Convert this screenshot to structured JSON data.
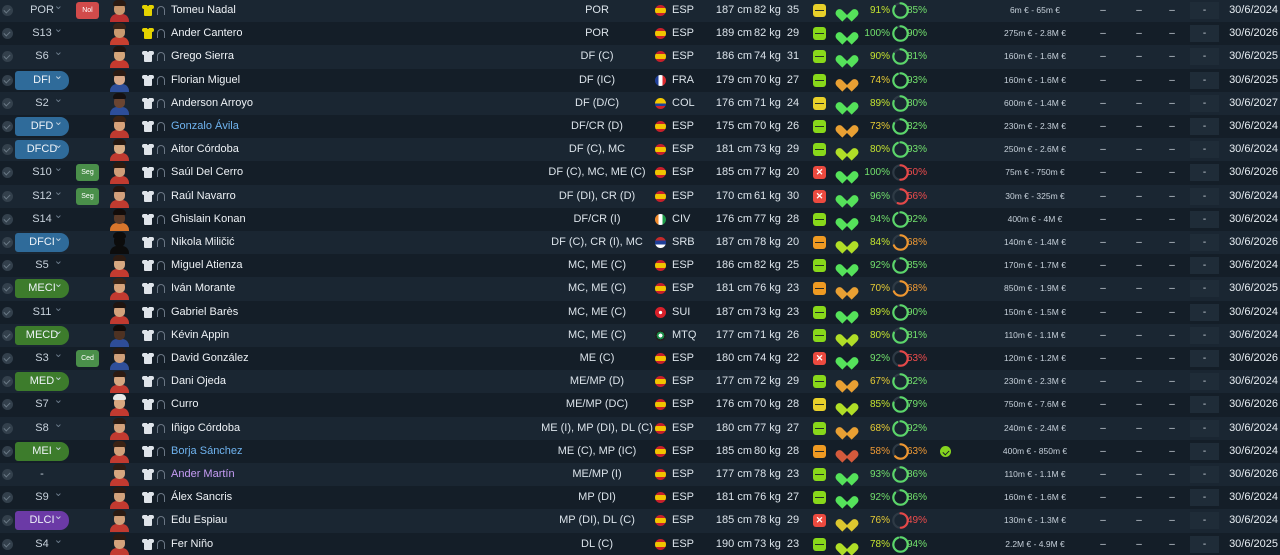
{
  "app": {
    "view": "squad-list",
    "colors": {
      "background": "#16212b",
      "row_even": "#1a2632",
      "row_odd": "#141e28",
      "chip_blue": "#2f6b9a",
      "chip_green": "#3d7c2c",
      "chip_purple": "#6b3aa6",
      "loan_name": "#6fb3ef",
      "purple_name": "#c69cf5",
      "role_red": "#d24b4b",
      "role_green": "#4a8f4a"
    }
  },
  "players": [
    {
      "pos": "POR",
      "pos_style": "plain",
      "role": "Nol",
      "role_style": "red",
      "face": [
        "#2a1a12",
        "#c9986e",
        "#bb3030"
      ],
      "shirt": "gk",
      "tag": true,
      "name": "Tomeu Nadal",
      "name_style": "normal",
      "positions": "POR",
      "flag": "esp",
      "nat": "ESP",
      "height": "187 cm",
      "weight": "82 kg",
      "age": "35",
      "morale": "mid",
      "heart": "green",
      "cond": "91%",
      "cond_color": "lime",
      "cond_level": 0.91,
      "sharp": "85%",
      "sharp_color": "green",
      "sharp_level": 0.85,
      "extra": false,
      "value": "6m € - 65m €",
      "d1": "–",
      "d2": "–",
      "d3": "–",
      "d4": "-",
      "contract": "30/6/2024"
    },
    {
      "pos": "S13",
      "pos_style": "plain",
      "role": "",
      "role_style": "",
      "face": [
        "#3a2418",
        "#c99a70",
        "#c84030"
      ],
      "shirt": "gk",
      "tag": true,
      "name": "Ander Cantero",
      "name_style": "normal",
      "positions": "POR",
      "flag": "esp",
      "nat": "ESP",
      "height": "189 cm",
      "weight": "82 kg",
      "age": "29",
      "morale": "pos",
      "heart": "green",
      "cond": "100%",
      "cond_color": "green",
      "cond_level": 1.0,
      "sharp": "90%",
      "sharp_color": "green",
      "sharp_level": 0.9,
      "extra": false,
      "value": "275m € - 2.8M €",
      "d1": "–",
      "d2": "–",
      "d3": "–",
      "d4": "-",
      "contract": "30/6/2026"
    },
    {
      "pos": "S6",
      "pos_style": "plain",
      "role": "",
      "role_style": "",
      "face": [
        "#1d1410",
        "#d4a57a",
        "#c73a2f"
      ],
      "shirt": "fd",
      "tag": true,
      "name": "Grego Sierra",
      "name_style": "normal",
      "positions": "DF (C)",
      "flag": "esp",
      "nat": "ESP",
      "height": "186 cm",
      "weight": "74 kg",
      "age": "31",
      "morale": "pos",
      "heart": "green",
      "cond": "90%",
      "cond_color": "lime",
      "cond_level": 0.9,
      "sharp": "81%",
      "sharp_color": "green",
      "sharp_level": 0.81,
      "extra": false,
      "value": "160m € - 1.6M €",
      "d1": "–",
      "d2": "–",
      "d3": "–",
      "d4": "-",
      "contract": "30/6/2025"
    },
    {
      "pos": "DFI",
      "pos_style": "blue",
      "role": "",
      "role_style": "",
      "face": [
        "#2b1a12",
        "#d8a98a",
        "#2f4f9a"
      ],
      "shirt": "fd",
      "tag": true,
      "name": "Florian Miguel",
      "name_style": "normal",
      "positions": "DF (IC)",
      "flag": "fra",
      "nat": "FRA",
      "height": "179 cm",
      "weight": "70 kg",
      "age": "27",
      "morale": "pos",
      "heart": "amber",
      "cond": "74%",
      "cond_color": "yellow",
      "cond_level": 0.74,
      "sharp": "93%",
      "sharp_color": "green",
      "sharp_level": 0.93,
      "extra": false,
      "value": "160m € - 1.6M €",
      "d1": "–",
      "d2": "–",
      "d3": "–",
      "d4": "-",
      "contract": "30/6/2025"
    },
    {
      "pos": "S2",
      "pos_style": "plain",
      "role": "",
      "role_style": "",
      "face": [
        "#151010",
        "#6b4532",
        "#2d4e9a"
      ],
      "shirt": "fd",
      "tag": true,
      "name": "Anderson Arroyo",
      "name_style": "normal",
      "positions": "DF (D/C)",
      "flag": "col",
      "nat": "COL",
      "height": "176 cm",
      "weight": "71 kg",
      "age": "24",
      "morale": "mid",
      "heart": "green",
      "cond": "89%",
      "cond_color": "lime",
      "cond_level": 0.89,
      "sharp": "80%",
      "sharp_color": "green",
      "sharp_level": 0.8,
      "extra": false,
      "value": "600m € - 1.4M €",
      "d1": "–",
      "d2": "–",
      "d3": "–",
      "d4": "-",
      "contract": "30/6/2027"
    },
    {
      "pos": "DFD",
      "pos_style": "blue",
      "role": "",
      "role_style": "",
      "face": [
        "#3c2314",
        "#d7a27a",
        "#bf3a30"
      ],
      "shirt": "fd",
      "tag": true,
      "name": "Gonzalo Ávila",
      "name_style": "loan",
      "positions": "DF/CR (D)",
      "flag": "esp",
      "nat": "ESP",
      "height": "175 cm",
      "weight": "70 kg",
      "age": "26",
      "morale": "pos",
      "heart": "amber",
      "cond": "73%",
      "cond_color": "yellow",
      "cond_level": 0.73,
      "sharp": "82%",
      "sharp_color": "green",
      "sharp_level": 0.82,
      "extra": false,
      "value": "230m € - 2.3M €",
      "d1": "–",
      "d2": "–",
      "d3": "–",
      "d4": "-",
      "contract": "30/6/2024"
    },
    {
      "pos": "DFCD",
      "pos_style": "blue",
      "role": "",
      "role_style": "",
      "face": [
        "#241710",
        "#d9ae86",
        "#c03a30"
      ],
      "shirt": "fd",
      "tag": true,
      "name": "Aitor Córdoba",
      "name_style": "normal",
      "positions": "DF (C), MC",
      "flag": "esp",
      "nat": "ESP",
      "height": "181 cm",
      "weight": "73 kg",
      "age": "29",
      "morale": "pos",
      "heart": "lime",
      "cond": "80%",
      "cond_color": "lime",
      "cond_level": 0.8,
      "sharp": "93%",
      "sharp_color": "green",
      "sharp_level": 0.93,
      "extra": false,
      "value": "250m € - 2.6M €",
      "d1": "–",
      "d2": "–",
      "d3": "–",
      "d4": "-",
      "contract": "30/6/2024"
    },
    {
      "pos": "S10",
      "pos_style": "plain",
      "role": "Seg",
      "role_style": "green",
      "face": [
        "#2a1a10",
        "#cf9d78",
        "#c13b30"
      ],
      "shirt": "fd",
      "tag": true,
      "name": "Saúl Del Cerro",
      "name_style": "normal",
      "positions": "DF (C), MC, ME (C)",
      "flag": "esp",
      "nat": "ESP",
      "height": "185 cm",
      "weight": "77 kg",
      "age": "20",
      "morale": "neg",
      "heart": "green",
      "cond": "100%",
      "cond_color": "green",
      "cond_level": 1.0,
      "sharp": "50%",
      "sharp_color": "red",
      "sharp_level": 0.5,
      "extra": false,
      "value": "75m € - 750m €",
      "d1": "–",
      "d2": "–",
      "d3": "–",
      "d4": "-",
      "contract": "30/6/2026"
    },
    {
      "pos": "S12",
      "pos_style": "plain",
      "role": "Seg",
      "role_style": "green",
      "face": [
        "#221510",
        "#d2a07c",
        "#c13b30"
      ],
      "shirt": "fd",
      "tag": true,
      "name": "Raúl Navarro",
      "name_style": "normal",
      "positions": "DF (DI), CR (D)",
      "flag": "esp",
      "nat": "ESP",
      "height": "170 cm",
      "weight": "61 kg",
      "age": "30",
      "morale": "neg",
      "heart": "green",
      "cond": "96%",
      "cond_color": "green",
      "cond_level": 0.96,
      "sharp": "56%",
      "sharp_color": "red",
      "sharp_level": 0.56,
      "extra": false,
      "value": "30m € - 325m €",
      "d1": "–",
      "d2": "–",
      "d3": "–",
      "d4": "-",
      "contract": "30/6/2024"
    },
    {
      "pos": "S14",
      "pos_style": "plain",
      "role": "",
      "role_style": "",
      "face": [
        "#120c0a",
        "#5a3a28",
        "#d8762c"
      ],
      "shirt": "fd",
      "tag": true,
      "name": "Ghislain Konan",
      "name_style": "normal",
      "positions": "DF/CR (I)",
      "flag": "civ",
      "nat": "CIV",
      "height": "176 cm",
      "weight": "77 kg",
      "age": "28",
      "morale": "pos",
      "heart": "green",
      "cond": "94%",
      "cond_color": "green",
      "cond_level": 0.94,
      "sharp": "92%",
      "sharp_color": "green",
      "sharp_level": 0.92,
      "extra": false,
      "value": "400m € - 4M €",
      "d1": "–",
      "d2": "–",
      "d3": "–",
      "d4": "-",
      "contract": "30/6/2024"
    },
    {
      "pos": "DFCI",
      "pos_style": "blue",
      "role": "",
      "role_style": "",
      "face": [
        "#0c0c0c",
        "#0c0c0c",
        "#0c0c0c"
      ],
      "shirt": "fd",
      "tag": true,
      "name": "Nikola Miličić",
      "name_style": "normal",
      "positions": "DF (C), CR (I), MC",
      "flag": "srb",
      "nat": "SRB",
      "height": "187 cm",
      "weight": "78 kg",
      "age": "20",
      "morale": "low",
      "heart": "lime",
      "cond": "84%",
      "cond_color": "lime",
      "cond_level": 0.84,
      "sharp": "68%",
      "sharp_color": "amber",
      "sharp_level": 0.68,
      "extra": false,
      "value": "140m € - 1.4M €",
      "d1": "–",
      "d2": "–",
      "d3": "–",
      "d4": "-",
      "contract": "30/6/2026"
    },
    {
      "pos": "S5",
      "pos_style": "plain",
      "role": "",
      "role_style": "",
      "face": [
        "#2c1b12",
        "#d6a882",
        "#c33b30"
      ],
      "shirt": "fd",
      "tag": true,
      "name": "Miguel Atienza",
      "name_style": "normal",
      "positions": "MC, ME (C)",
      "flag": "esp",
      "nat": "ESP",
      "height": "186 cm",
      "weight": "82 kg",
      "age": "25",
      "morale": "pos",
      "heart": "green",
      "cond": "92%",
      "cond_color": "green",
      "cond_level": 0.92,
      "sharp": "85%",
      "sharp_color": "green",
      "sharp_level": 0.85,
      "extra": false,
      "value": "170m € - 1.7M €",
      "d1": "–",
      "d2": "–",
      "d3": "–",
      "d4": "-",
      "contract": "30/6/2024"
    },
    {
      "pos": "MECI",
      "pos_style": "green",
      "role": "",
      "role_style": "",
      "face": [
        "#3a2416",
        "#d7a47c",
        "#c23a30"
      ],
      "shirt": "fd",
      "tag": true,
      "name": "Iván Morante",
      "name_style": "normal",
      "positions": "MC, ME (C)",
      "flag": "esp",
      "nat": "ESP",
      "height": "181 cm",
      "weight": "76 kg",
      "age": "23",
      "morale": "low",
      "heart": "amber",
      "cond": "70%",
      "cond_color": "yellow",
      "cond_level": 0.7,
      "sharp": "68%",
      "sharp_color": "amber",
      "sharp_level": 0.68,
      "extra": false,
      "value": "850m € - 1.9M €",
      "d1": "–",
      "d2": "–",
      "d3": "–",
      "d4": "-",
      "contract": "30/6/2025"
    },
    {
      "pos": "S11",
      "pos_style": "plain",
      "role": "",
      "role_style": "",
      "face": [
        "#1f1410",
        "#d3a27c",
        "#c13a30"
      ],
      "shirt": "fd",
      "tag": true,
      "name": "Gabriel Barès",
      "name_style": "normal",
      "positions": "MC, ME (C)",
      "flag": "sui",
      "nat": "SUI",
      "height": "187 cm",
      "weight": "73 kg",
      "age": "23",
      "morale": "pos",
      "heart": "green",
      "cond": "89%",
      "cond_color": "lime",
      "cond_level": 0.89,
      "sharp": "90%",
      "sharp_color": "green",
      "sharp_level": 0.9,
      "extra": false,
      "value": "150m € - 1.5M €",
      "d1": "–",
      "d2": "–",
      "d3": "–",
      "d4": "-",
      "contract": "30/6/2024"
    },
    {
      "pos": "MECD",
      "pos_style": "green",
      "role": "",
      "role_style": "",
      "face": [
        "#120c0a",
        "#4e3222",
        "#2e4d98"
      ],
      "shirt": "fd",
      "tag": true,
      "name": "Kévin Appin",
      "name_style": "normal",
      "positions": "MC, ME (C)",
      "flag": "mtq",
      "nat": "MTQ",
      "height": "177 cm",
      "weight": "71 kg",
      "age": "26",
      "morale": "pos",
      "heart": "lime",
      "cond": "80%",
      "cond_color": "lime",
      "cond_level": 0.8,
      "sharp": "81%",
      "sharp_color": "green",
      "sharp_level": 0.81,
      "extra": false,
      "value": "110m € - 1.1M €",
      "d1": "–",
      "d2": "–",
      "d3": "–",
      "d4": "-",
      "contract": "30/6/2024"
    },
    {
      "pos": "S3",
      "pos_style": "plain",
      "role": "Ced",
      "role_style": "green",
      "face": [
        "#2a1a12",
        "#d0a07a",
        "#2f4f9a"
      ],
      "shirt": "fd",
      "tag": true,
      "name": "David González",
      "name_style": "normal",
      "positions": "ME (C)",
      "flag": "esp",
      "nat": "ESP",
      "height": "180 cm",
      "weight": "74 kg",
      "age": "22",
      "morale": "neg",
      "heart": "green",
      "cond": "92%",
      "cond_color": "green",
      "cond_level": 0.92,
      "sharp": "53%",
      "sharp_color": "red",
      "sharp_level": 0.53,
      "extra": false,
      "value": "120m € - 1.2M €",
      "d1": "–",
      "d2": "–",
      "d3": "–",
      "d4": "-",
      "contract": "30/6/2026"
    },
    {
      "pos": "MED",
      "pos_style": "green",
      "role": "",
      "role_style": "",
      "face": [
        "#2b1a12",
        "#d6a680",
        "#c23a30"
      ],
      "shirt": "fd",
      "tag": true,
      "name": "Dani Ojeda",
      "name_style": "normal",
      "positions": "ME/MP (D)",
      "flag": "esp",
      "nat": "ESP",
      "height": "177 cm",
      "weight": "72 kg",
      "age": "29",
      "morale": "pos",
      "heart": "amber",
      "cond": "67%",
      "cond_color": "yellow",
      "cond_level": 0.67,
      "sharp": "82%",
      "sharp_color": "green",
      "sharp_level": 0.82,
      "extra": false,
      "value": "230m € - 2.3M €",
      "d1": "–",
      "d2": "–",
      "d3": "–",
      "d4": "-",
      "contract": "30/6/2024"
    },
    {
      "pos": "S7",
      "pos_style": "plain",
      "role": "",
      "role_style": "",
      "face": [
        "#e8e8e8",
        "#d8a880",
        "#c23a30"
      ],
      "shirt": "fd",
      "tag": true,
      "name": "Curro",
      "name_style": "normal",
      "positions": "ME/MP (DC)",
      "flag": "esp",
      "nat": "ESP",
      "height": "176 cm",
      "weight": "70 kg",
      "age": "28",
      "morale": "mid",
      "heart": "lime",
      "cond": "85%",
      "cond_color": "lime",
      "cond_level": 0.85,
      "sharp": "79%",
      "sharp_color": "green",
      "sharp_level": 0.79,
      "extra": false,
      "value": "750m € - 7.6M €",
      "d1": "–",
      "d2": "–",
      "d3": "–",
      "d4": "-",
      "contract": "30/6/2026"
    },
    {
      "pos": "S8",
      "pos_style": "plain",
      "role": "",
      "role_style": "",
      "face": [
        "#2a1a12",
        "#d4a27c",
        "#c23a30"
      ],
      "shirt": "fd",
      "tag": true,
      "name": "Iñigo Córdoba",
      "name_style": "normal",
      "positions": "ME (I), MP (DI), DL (C)",
      "flag": "esp",
      "nat": "ESP",
      "height": "180 cm",
      "weight": "77 kg",
      "age": "27",
      "morale": "pos",
      "heart": "amber",
      "cond": "68%",
      "cond_color": "yellow",
      "cond_level": 0.68,
      "sharp": "92%",
      "sharp_color": "green",
      "sharp_level": 0.92,
      "extra": false,
      "value": "240m € - 2.4M €",
      "d1": "–",
      "d2": "–",
      "d3": "–",
      "d4": "-",
      "contract": "30/6/2024"
    },
    {
      "pos": "MEI",
      "pos_style": "green",
      "role": "",
      "role_style": "",
      "face": [
        "#3a2214",
        "#d2a07a",
        "#c23a30"
      ],
      "shirt": "fd",
      "tag": true,
      "name": "Borja Sánchez",
      "name_style": "loan",
      "positions": "ME (C), MP (IC)",
      "flag": "esp",
      "nat": "ESP",
      "height": "185 cm",
      "weight": "80 kg",
      "age": "28",
      "morale": "low",
      "heart": "red",
      "cond": "58%",
      "cond_color": "amber",
      "cond_level": 0.58,
      "sharp": "63%",
      "sharp_color": "amber",
      "sharp_level": 0.63,
      "extra": true,
      "value": "400m € - 850m €",
      "d1": "–",
      "d2": "–",
      "d3": "–",
      "d4": "-",
      "contract": "30/6/2024"
    },
    {
      "pos": "-",
      "pos_style": "plain",
      "role": "",
      "role_style": "",
      "face": [
        "#2c1c14",
        "#d6a680",
        "#c23a30"
      ],
      "shirt": "fd",
      "tag": true,
      "name": "Ander Martín",
      "name_style": "purple",
      "positions": "ME/MP (I)",
      "flag": "esp",
      "nat": "ESP",
      "height": "177 cm",
      "weight": "78 kg",
      "age": "23",
      "morale": "pos",
      "heart": "green",
      "cond": "93%",
      "cond_color": "green",
      "cond_level": 0.93,
      "sharp": "86%",
      "sharp_color": "green",
      "sharp_level": 0.86,
      "extra": false,
      "value": "110m € - 1.1M €",
      "d1": "–",
      "d2": "–",
      "d3": "–",
      "d4": "-",
      "contract": "30/6/2026"
    },
    {
      "pos": "S9",
      "pos_style": "plain",
      "role": "",
      "role_style": "",
      "face": [
        "#2a1a12",
        "#d2a27c",
        "#c23a30"
      ],
      "shirt": "fd",
      "tag": true,
      "name": "Álex Sancris",
      "name_style": "normal",
      "positions": "MP (DI)",
      "flag": "esp",
      "nat": "ESP",
      "height": "181 cm",
      "weight": "76 kg",
      "age": "27",
      "morale": "pos",
      "heart": "green",
      "cond": "92%",
      "cond_color": "green",
      "cond_level": 0.92,
      "sharp": "86%",
      "sharp_color": "green",
      "sharp_level": 0.86,
      "extra": false,
      "value": "160m € - 1.6M €",
      "d1": "–",
      "d2": "–",
      "d3": "–",
      "d4": "-",
      "contract": "30/6/2024"
    },
    {
      "pos": "DLCI",
      "pos_style": "purple",
      "role": "",
      "role_style": "",
      "face": [
        "#2a1a12",
        "#d0a07a",
        "#c23a30"
      ],
      "shirt": "fd",
      "tag": true,
      "name": "Edu Espiau",
      "name_style": "normal",
      "positions": "MP (DI), DL (C)",
      "flag": "esp",
      "nat": "ESP",
      "height": "185 cm",
      "weight": "78 kg",
      "age": "29",
      "morale": "neg",
      "heart": "yellow",
      "cond": "76%",
      "cond_color": "yellow",
      "cond_level": 0.76,
      "sharp": "49%",
      "sharp_color": "red",
      "sharp_level": 0.49,
      "extra": false,
      "value": "130m € - 1.3M €",
      "d1": "–",
      "d2": "–",
      "d3": "–",
      "d4": "-",
      "contract": "30/6/2024"
    },
    {
      "pos": "S4",
      "pos_style": "plain",
      "role": "",
      "role_style": "",
      "face": [
        "#2a1a12",
        "#d3a27c",
        "#c23a30"
      ],
      "shirt": "fd",
      "tag": true,
      "name": "Fer Niño",
      "name_style": "normal",
      "positions": "DL (C)",
      "flag": "esp",
      "nat": "ESP",
      "height": "190 cm",
      "weight": "73 kg",
      "age": "23",
      "morale": "pos",
      "heart": "lime",
      "cond": "78%",
      "cond_color": "lime",
      "cond_level": 0.78,
      "sharp": "94%",
      "sharp_color": "green",
      "sharp_level": 0.94,
      "extra": false,
      "value": "2.2M € - 4.9M €",
      "d1": "–",
      "d2": "–",
      "d3": "–",
      "d4": "-",
      "contract": "30/6/2025"
    }
  ]
}
